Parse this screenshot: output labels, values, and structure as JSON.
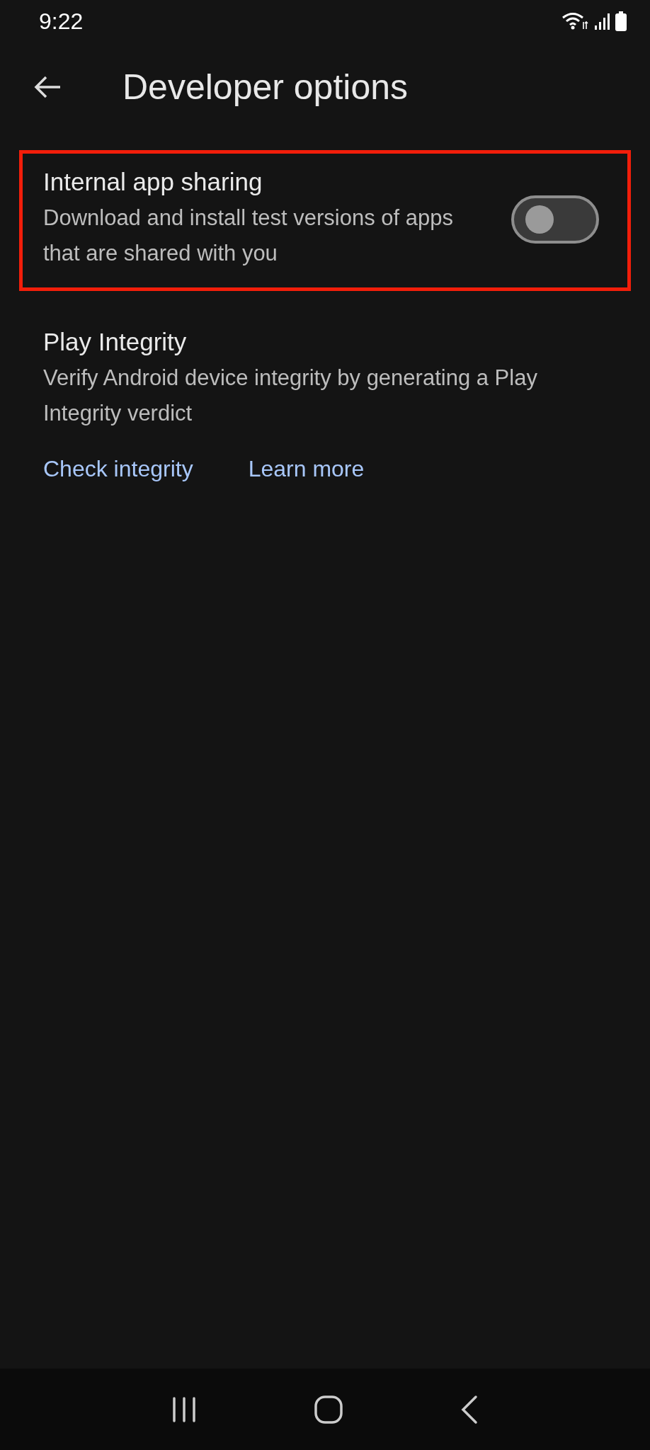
{
  "status_bar": {
    "time": "9:22"
  },
  "app_bar": {
    "title": "Developer options"
  },
  "settings": [
    {
      "kind": "toggle",
      "title": "Internal app sharing",
      "description": "Download and install test versions of apps that are shared with you",
      "on": false,
      "highlighted": true
    },
    {
      "kind": "links",
      "title": "Play Integrity",
      "description": "Verify Android device integrity by generating a Play Integrity verdict",
      "highlighted": false,
      "links": [
        "Check integrity",
        "Learn more"
      ]
    }
  ]
}
